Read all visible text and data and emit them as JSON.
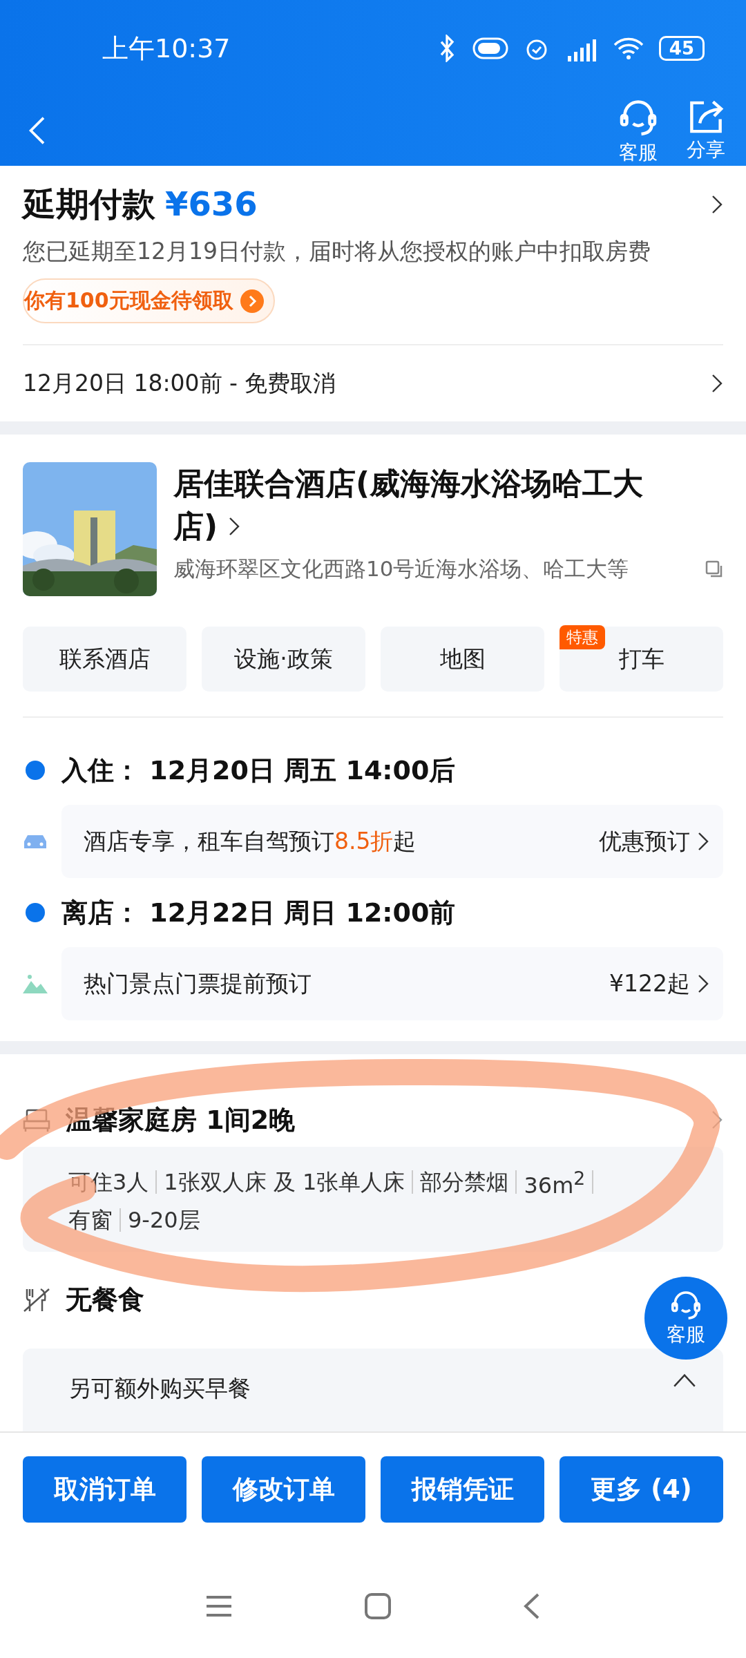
{
  "status_bar": {
    "time": "上午10:37",
    "battery": "45"
  },
  "header": {
    "actions": [
      {
        "kind": "service",
        "label": "客服"
      },
      {
        "kind": "share",
        "label": "分享"
      }
    ]
  },
  "payment": {
    "title": "延期付款",
    "amount": "¥636",
    "note": "您已延期至12月19日付款，届时将从您授权的账户中扣取房费",
    "promo": "你有100元现金待领取",
    "cancel_policy": "12月20日 18:00前 - 免费取消"
  },
  "hotel": {
    "name": "居佳联合酒店(威海海水浴场哈工大店)",
    "address": "威海环翠区文化西路10号近海水浴场、哈工大等",
    "actions": [
      {
        "label": "联系酒店"
      },
      {
        "label": "设施·政策"
      },
      {
        "label": "地图"
      },
      {
        "label": "打车",
        "badge": "特惠"
      }
    ]
  },
  "stay": [
    {
      "kind": "date",
      "label": "入住：",
      "value": "12月20日 周五 14:00后"
    },
    {
      "kind": "rental",
      "prefix": "酒店专享，租车自驾预订",
      "highlight": "8.5折",
      "suffix": "起",
      "action": "优惠预订"
    },
    {
      "kind": "date",
      "label": "离店：",
      "value": "12月22日 周日 12:00前"
    },
    {
      "kind": "tickets",
      "prefix": "热门景点门票提前预订",
      "action": "¥122起"
    }
  ],
  "room": {
    "title": "温馨家庭房",
    "count": "1间2晚",
    "specs": [
      "可住3人",
      "1张双人床 及 1张单人床",
      "部分禁烟",
      "36m$^{2}$",
      "有窗",
      "9-20层"
    ]
  },
  "meal": {
    "title": "无餐食",
    "extra": {
      "label": "另可额外购买早餐",
      "expanded": true
    }
  },
  "float_service": {
    "label": "客服"
  },
  "bottom_actions": [
    "取消订单",
    "修改订单",
    "报销凭证",
    "更多 (4)"
  ]
}
